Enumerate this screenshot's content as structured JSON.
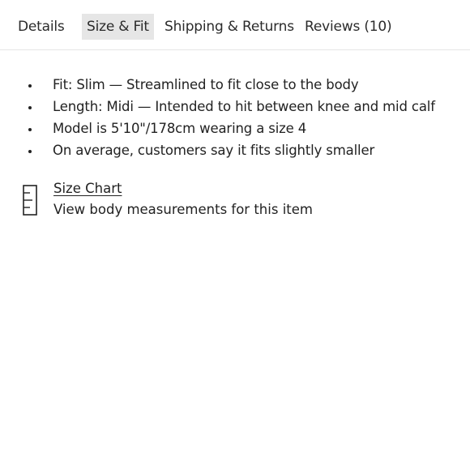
{
  "tabs": {
    "details": "Details",
    "size_fit": "Size & Fit",
    "shipping_returns": "Shipping & Returns",
    "reviews": "Reviews (10)",
    "active": "size_fit"
  },
  "fit_details": [
    "Fit: Slim — Streamlined to fit close to the body",
    "Length: Midi — Intended to hit between knee and mid calf",
    "Model is 5'10\"/178cm wearing a size 4",
    "On average, customers say it fits slightly smaller"
  ],
  "size_chart": {
    "icon": "ruler-icon",
    "link_label": "Size Chart",
    "description": "View body measurements for this item"
  },
  "colors": {
    "active_tab_bg": "#e6e6e6",
    "text": "#222222",
    "divider": "#e6e6e6"
  }
}
